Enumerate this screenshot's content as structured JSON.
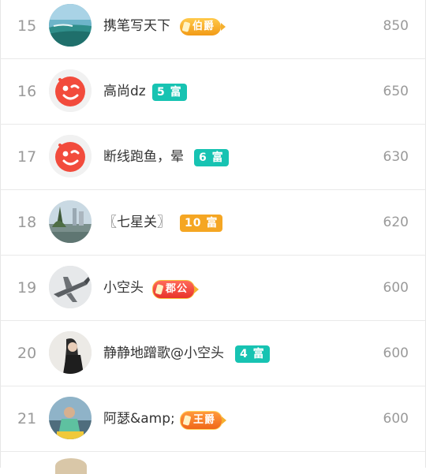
{
  "rows": [
    {
      "rank": "15",
      "name": "携笔写天下",
      "badge": "伯爵",
      "badge_type": "bojue",
      "score": "850",
      "avatar": "beach-photo"
    },
    {
      "rank": "16",
      "name": "高尚dz",
      "badge": "5 富",
      "badge_type": "rich",
      "score": "650",
      "avatar": "default-wink"
    },
    {
      "rank": "17",
      "name": "断线跑鱼，晕",
      "badge": "6 富",
      "badge_type": "rich",
      "score": "630",
      "avatar": "default-wink"
    },
    {
      "rank": "18",
      "name": "〖七星关〗",
      "badge": "10 富",
      "badge_type": "rich10",
      "score": "620",
      "avatar": "lake-photo"
    },
    {
      "rank": "19",
      "name": "小空头",
      "badge": "郡公",
      "badge_type": "jungong",
      "score": "600",
      "avatar": "plane-photo"
    },
    {
      "rank": "20",
      "name": "静静地蹭歌@小空头",
      "badge": "4 富",
      "badge_type": "rich",
      "score": "600",
      "avatar": "girl-photo"
    },
    {
      "rank": "21",
      "name": "阿瑟&amp;",
      "badge": "王爵",
      "badge_type": "wangjue",
      "score": "600",
      "avatar": "person-photo"
    }
  ],
  "colors": {
    "rich": "#17c3b2",
    "rich10": "#f5a623",
    "accent": "#f24b3c"
  }
}
